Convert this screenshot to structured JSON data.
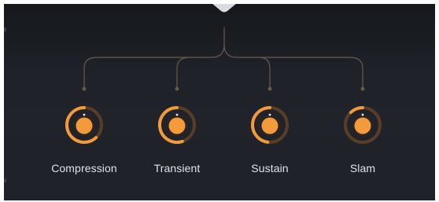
{
  "colors": {
    "accent": "#f39a3c",
    "accent_dim": "#5a3d25",
    "line": "#6a5a4a",
    "label": "#dfe2e8",
    "bg": "#1f2228"
  },
  "knobs": [
    {
      "label": "Compression",
      "value": 0.62
    },
    {
      "label": "Transient",
      "value": 0.55
    },
    {
      "label": "Sustain",
      "value": 0.48
    },
    {
      "label": "Slam",
      "value": 0.12
    }
  ]
}
